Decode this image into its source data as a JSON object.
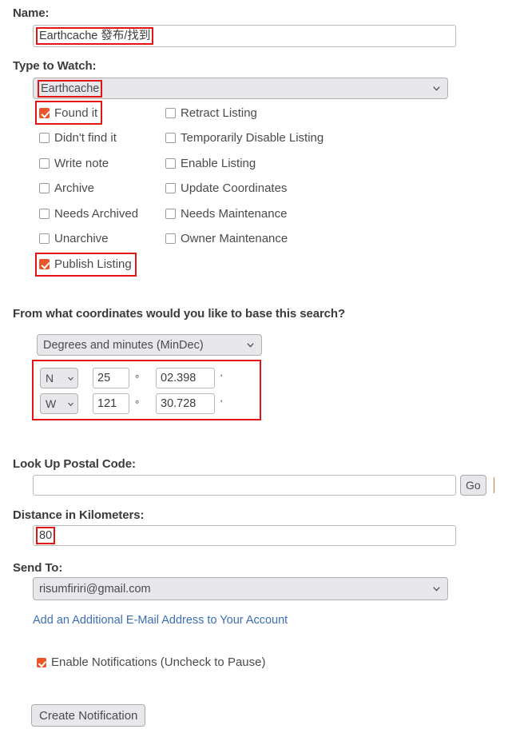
{
  "name_section": {
    "label": "Name:",
    "value": "Earthcache 發布/找到"
  },
  "type_section": {
    "label": "Type to Watch:",
    "selected": "Earthcache"
  },
  "watch_options": {
    "col1": [
      {
        "label": "Found it",
        "checked": true,
        "highlighted": true
      },
      {
        "label": "Didn't find it",
        "checked": false,
        "highlighted": false
      },
      {
        "label": "Write note",
        "checked": false,
        "highlighted": false
      },
      {
        "label": "Archive",
        "checked": false,
        "highlighted": false
      },
      {
        "label": "Needs Archived",
        "checked": false,
        "highlighted": false
      },
      {
        "label": "Unarchive",
        "checked": false,
        "highlighted": false
      },
      {
        "label": "Publish Listing",
        "checked": true,
        "highlighted": true
      }
    ],
    "col2": [
      {
        "label": "Retract Listing",
        "checked": false,
        "highlighted": false
      },
      {
        "label": "Temporarily Disable Listing",
        "checked": false,
        "highlighted": false
      },
      {
        "label": "Enable Listing",
        "checked": false,
        "highlighted": false
      },
      {
        "label": "Update Coordinates",
        "checked": false,
        "highlighted": false
      },
      {
        "label": "Needs Maintenance",
        "checked": false,
        "highlighted": false
      },
      {
        "label": "Owner Maintenance",
        "checked": false,
        "highlighted": false
      }
    ]
  },
  "coordinates": {
    "heading": "From what coordinates would you like to base this search?",
    "format_selected": "Degrees and minutes (MinDec)",
    "lat": {
      "direction": "N",
      "degrees": "25",
      "degree_symbol": "°",
      "minutes": "02.398",
      "minute_symbol": "'"
    },
    "lon": {
      "direction": "W",
      "degrees": "121",
      "degree_symbol": "°",
      "minutes": "30.728",
      "minute_symbol": "'"
    }
  },
  "postal": {
    "label": "Look Up Postal Code:",
    "value": "",
    "go_label": "Go"
  },
  "distance": {
    "label": "Distance in Kilometers:",
    "value": "80"
  },
  "send_to": {
    "label": "Send To:",
    "selected": "risumfiriri@gmail.com",
    "add_email_link": "Add an Additional E-Mail Address to Your Account"
  },
  "enable_notifications": {
    "label": "Enable Notifications (Uncheck to Pause)",
    "checked": true
  },
  "submit": {
    "label": "Create Notification"
  },
  "colors": {
    "checkbox_checked": "#e8562a",
    "highlight_outline": "#e31414",
    "link": "#3c6eb4",
    "label_text": "#3b3b3b"
  }
}
